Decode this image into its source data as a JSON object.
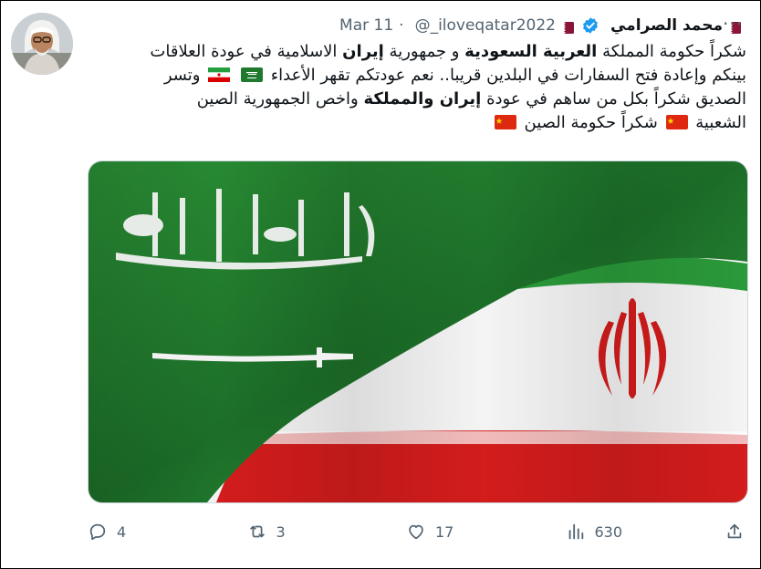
{
  "tweet": {
    "display_name": "محمد الصرامي",
    "handle": "@_iloveqatar2022",
    "date": "Mar 11",
    "more_label": "···",
    "text_line1_a": "شكراً حكومة المملكة ",
    "text_line1_b": "العربية السعودية",
    "text_line1_c": " و جمهورية ",
    "text_line1_d": "إيران",
    "text_line1_e": " الاسلامية في عودة العلاقات",
    "text_line2": "بينكم وإعادة فتح السفارات في البلدين قريبا.. نعم عودتكم تقهر الأعداء",
    "text_line2_end": " وتسر",
    "text_line3_a": "الصديق شكراً بكل من ساهم في عودة ",
    "text_line3_b": "إيران والمملكة",
    "text_line3_c": " واخص الجمهورية الصين",
    "text_line4_a": "الشعبية ",
    "text_line4_b": " شكراً حكومة الصين "
  },
  "actions": {
    "replies": "4",
    "retweets": "3",
    "likes": "17",
    "views": "630"
  },
  "colors": {
    "text": "#0f1419",
    "muted": "#536471",
    "verified": "#1d9bf0",
    "qatar_maroon": "#8a1538",
    "saudi_green": "#1f7a2e",
    "iran_green": "#239f40",
    "iran_red": "#da0000"
  },
  "icons": [
    "more-icon",
    "verified-icon",
    "qatar-flag-icon",
    "saudi-flag-icon",
    "iran-flag-icon",
    "china-flag-icon",
    "reply-icon",
    "retweet-icon",
    "like-icon",
    "views-icon",
    "share-icon"
  ]
}
